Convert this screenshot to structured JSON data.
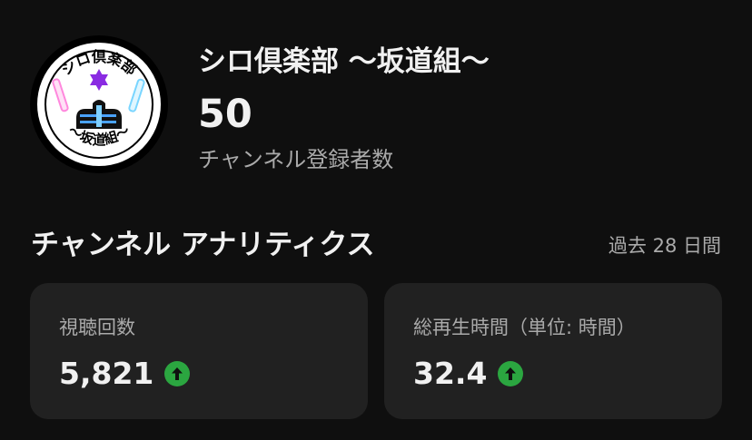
{
  "channel": {
    "name": "シロ倶楽部 〜坂道組〜",
    "subscriber_count": "50",
    "subscriber_label": "チャンネル登録者数",
    "avatar": {
      "top_text": "シロ倶楽部",
      "bottom_text": "〜坂道組〜"
    }
  },
  "analytics": {
    "title": "チャンネル アナリティクス",
    "period": "過去 28 日間",
    "metrics": [
      {
        "label": "視聴回数",
        "value": "5,821",
        "trend": "up",
        "trend_icon": "arrow-up-icon"
      },
      {
        "label": "総再生時間（単位: 時間）",
        "value": "32.4",
        "trend": "up",
        "trend_icon": "arrow-up-icon"
      }
    ]
  },
  "colors": {
    "background": "#0f0f0f",
    "card": "#212121",
    "text_primary": "#f1f1f1",
    "text_secondary": "#aaaaaa",
    "trend_up": "#2ba640"
  }
}
